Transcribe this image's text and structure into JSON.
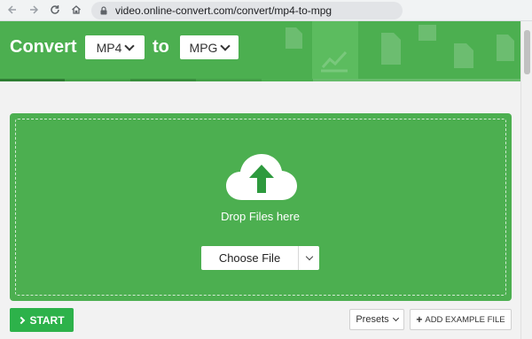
{
  "browser": {
    "url": "video.online-convert.com/convert/mp4-to-mpg",
    "icons": [
      "back-icon",
      "forward-icon",
      "reload-icon",
      "home-icon",
      "lock-icon"
    ]
  },
  "header": {
    "title": "Convert",
    "from_format": "MP4",
    "to_word": "to",
    "to_format": "MPG",
    "color": "#4caf50"
  },
  "upload": {
    "drop_text": "Drop Files here",
    "choose_label": "Choose File"
  },
  "actions": {
    "start_label": "START",
    "presets_label": "Presets",
    "example_label": "ADD EXAMPLE FILE",
    "example_plus": "+"
  },
  "colors": {
    "accent": "#4caf50",
    "start_button": "#2db24a"
  }
}
